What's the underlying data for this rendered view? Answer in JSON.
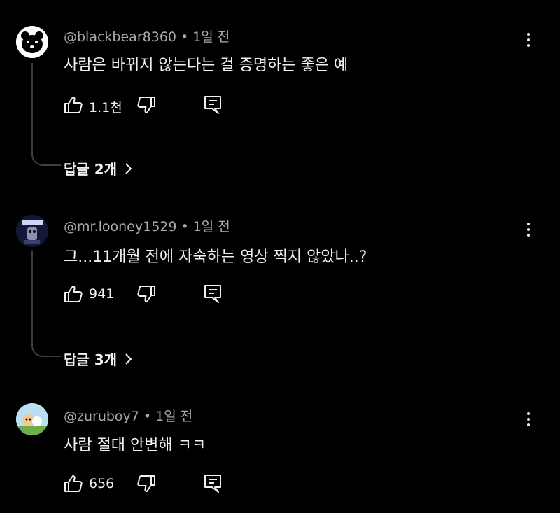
{
  "comments": [
    {
      "author": "@blackbear8360",
      "separator": "•",
      "time": "1일 전",
      "text": "사람은 바뀌지 않는다는 걸 증명하는 좋은 예",
      "likes": "1.1천",
      "replies_label": "답글 2개",
      "avatar_color": "#ffffff",
      "icons": [
        "like-icon",
        "dislike-icon",
        "reply-icon",
        "more-icon",
        "chevron-right-icon"
      ]
    },
    {
      "author": "@mr.looney1529",
      "separator": "•",
      "time": "1일 전",
      "text": "그...11개월 전에 자숙하는 영상 찍지 않았나..?",
      "likes": "941",
      "replies_label": "답글 3개",
      "avatar_color": "#1d2240"
    },
    {
      "author": "@zuruboy7",
      "separator": "•",
      "time": "1일 전",
      "text": "사람 절대 안변해 ㅋㅋ",
      "likes": "656",
      "avatar_color": "#9fd0e8"
    }
  ],
  "colors": {
    "background": "#000000",
    "text": "#f1f1f1",
    "meta": "#aaaaaa",
    "thread_line": "#3f3f3f"
  }
}
